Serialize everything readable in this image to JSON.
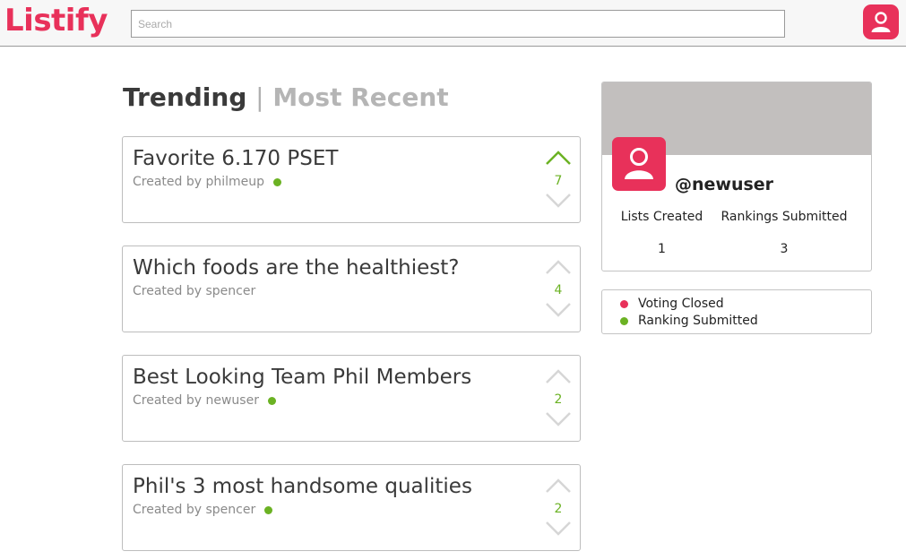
{
  "header": {
    "logo": "Listify",
    "search_placeholder": "Search",
    "avatar_icon": "user-icon"
  },
  "tabs": {
    "active": "Trending",
    "separator": "|",
    "inactive": "Most Recent"
  },
  "lists": [
    {
      "title": "Favorite 6.170 PSET",
      "author": "Created by philmeup",
      "status": "ranking-submitted",
      "votes": "7",
      "upvoted": true
    },
    {
      "title": "Which foods are the healthiest?",
      "author": "Created by spencer",
      "status": "none",
      "votes": "4",
      "upvoted": false
    },
    {
      "title": "Best Looking Team Phil Members",
      "author": "Created by newuser",
      "status": "ranking-submitted",
      "votes": "2",
      "upvoted": false
    },
    {
      "title": "Phil's 3 most handsome qualities",
      "author": "Created by spencer",
      "status": "ranking-submitted",
      "votes": "2",
      "upvoted": false
    }
  ],
  "profile": {
    "username": "@newuser",
    "lists_created_label": "Lists Created",
    "lists_created_value": "1",
    "rankings_submitted_label": "Rankings Submitted",
    "rankings_submitted_value": "3"
  },
  "legend": {
    "voting_closed": "Voting Closed",
    "ranking_submitted": "Ranking Submitted"
  },
  "colors": {
    "brand": "#e8315a",
    "green": "#6bb223",
    "arrow_inactive": "#d6d6d6",
    "banner": "#c2bfbe"
  }
}
